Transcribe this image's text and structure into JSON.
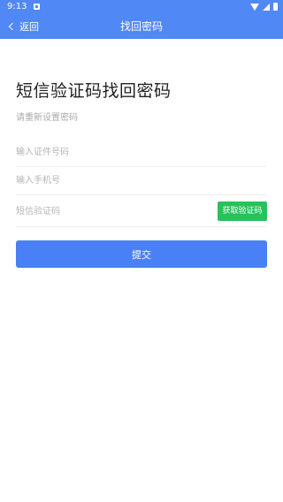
{
  "status_bar": {
    "time": "9:13"
  },
  "nav": {
    "back_label": "返回",
    "title": "找回密码"
  },
  "main": {
    "heading": "短信验证码找回密码",
    "subtitle": "请重新设置密码",
    "fields": {
      "id_number_placeholder": "输入证件号码",
      "phone_placeholder": "输入手机号",
      "sms_code_placeholder": "短信验证码"
    },
    "get_code_label": "获取验证码",
    "submit_label": "提交"
  },
  "colors": {
    "primary": "#4a80f5",
    "accent_green": "#27c25b"
  }
}
